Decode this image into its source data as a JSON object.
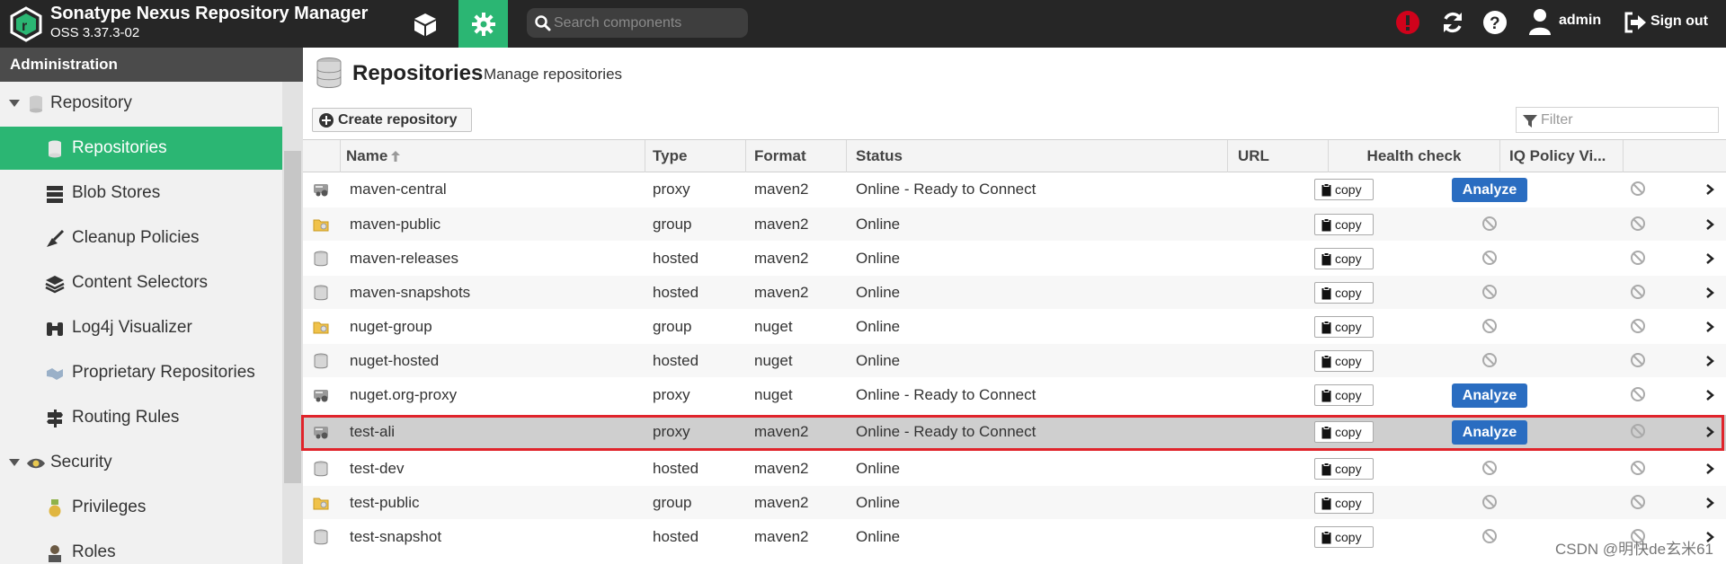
{
  "app": {
    "title": "Sonatype Nexus Repository Manager",
    "version": "OSS 3.37.3-02"
  },
  "topbar": {
    "search_placeholder": "Search components",
    "user_name": "admin",
    "signout_label": "Sign out"
  },
  "sidebar": {
    "header": "Administration",
    "items": [
      {
        "label": "Repository",
        "icon": "database-icon",
        "type": "group"
      },
      {
        "label": "Repositories",
        "icon": "database-icon",
        "type": "item",
        "active": true
      },
      {
        "label": "Blob Stores",
        "icon": "server-icon",
        "type": "item"
      },
      {
        "label": "Cleanup Policies",
        "icon": "broom-icon",
        "type": "item"
      },
      {
        "label": "Content Selectors",
        "icon": "layers-icon",
        "type": "item"
      },
      {
        "label": "Log4j Visualizer",
        "icon": "binoculars-icon",
        "type": "item"
      },
      {
        "label": "Proprietary Repositories",
        "icon": "handshake-icon",
        "type": "item"
      },
      {
        "label": "Routing Rules",
        "icon": "signpost-icon",
        "type": "item"
      },
      {
        "label": "Security",
        "icon": "eye-icon",
        "type": "group"
      },
      {
        "label": "Privileges",
        "icon": "medal-icon",
        "type": "item"
      },
      {
        "label": "Roles",
        "icon": "user-role-icon",
        "type": "item"
      }
    ]
  },
  "page": {
    "title": "Repositories",
    "subtitle": "Manage repositories",
    "create_label": "Create repository",
    "filter_placeholder": "Filter"
  },
  "grid": {
    "columns": [
      "Name",
      "Type",
      "Format",
      "Status",
      "URL",
      "Health check",
      "IQ Policy Vi..."
    ],
    "copy_label": "copy",
    "analyze_label": "Analyze",
    "rows": [
      {
        "name": "maven-central",
        "type": "proxy",
        "format": "maven2",
        "status": "Online - Ready to Connect",
        "analyze": true
      },
      {
        "name": "maven-public",
        "type": "group",
        "format": "maven2",
        "status": "Online",
        "analyze": false
      },
      {
        "name": "maven-releases",
        "type": "hosted",
        "format": "maven2",
        "status": "Online",
        "analyze": false
      },
      {
        "name": "maven-snapshots",
        "type": "hosted",
        "format": "maven2",
        "status": "Online",
        "analyze": false
      },
      {
        "name": "nuget-group",
        "type": "group",
        "format": "nuget",
        "status": "Online",
        "analyze": false
      },
      {
        "name": "nuget-hosted",
        "type": "hosted",
        "format": "nuget",
        "status": "Online",
        "analyze": false
      },
      {
        "name": "nuget.org-proxy",
        "type": "proxy",
        "format": "nuget",
        "status": "Online - Ready to Connect",
        "analyze": true
      },
      {
        "name": "test-ali",
        "type": "proxy",
        "format": "maven2",
        "status": "Online - Ready to Connect",
        "analyze": true,
        "selected": true
      },
      {
        "name": "test-dev",
        "type": "hosted",
        "format": "maven2",
        "status": "Online",
        "analyze": false
      },
      {
        "name": "test-public",
        "type": "group",
        "format": "maven2",
        "status": "Online",
        "analyze": false
      },
      {
        "name": "test-snapshot",
        "type": "hosted",
        "format": "maven2",
        "status": "Online",
        "analyze": false
      }
    ]
  },
  "watermark": "CSDN @明快de玄米61",
  "colors": {
    "topbar": "#262626",
    "accent_green": "#2bb673",
    "analyze_blue": "#2a6dc1",
    "selection_outline": "#e0242b",
    "alert_red": "#d0021b"
  }
}
